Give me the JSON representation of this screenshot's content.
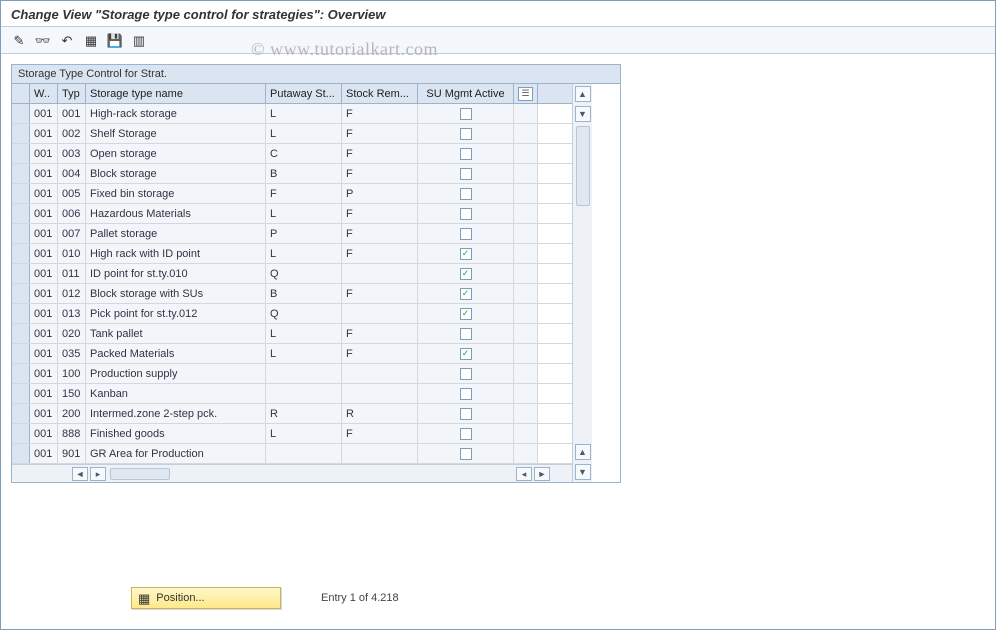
{
  "title": "Change View \"Storage type control for strategies\": Overview",
  "watermark": "© www.tutorialkart.com",
  "toolbar_icons": [
    {
      "name": "change-icon",
      "glyph": "✎"
    },
    {
      "name": "glasses-icon",
      "glyph": "👓"
    },
    {
      "name": "undo-icon",
      "glyph": "↶"
    },
    {
      "name": "select-all-icon",
      "glyph": "▦"
    },
    {
      "name": "save-icon",
      "glyph": "💾"
    },
    {
      "name": "deselect-icon",
      "glyph": "▥"
    }
  ],
  "grid": {
    "title": "Storage Type Control for Strat.",
    "columns": {
      "w": "W..",
      "typ": "Typ",
      "name": "Storage type name",
      "putaway": "Putaway St...",
      "stockrem": "Stock Rem...",
      "su": "SU Mgmt Active",
      "config": ""
    },
    "rows": [
      {
        "w": "001",
        "typ": "001",
        "name": "High-rack storage",
        "put": "L",
        "stk": "F",
        "su": false
      },
      {
        "w": "001",
        "typ": "002",
        "name": "Shelf Storage",
        "put": "L",
        "stk": "F",
        "su": false
      },
      {
        "w": "001",
        "typ": "003",
        "name": "Open storage",
        "put": "C",
        "stk": "F",
        "su": false
      },
      {
        "w": "001",
        "typ": "004",
        "name": "Block storage",
        "put": "B",
        "stk": "F",
        "su": false
      },
      {
        "w": "001",
        "typ": "005",
        "name": "Fixed bin storage",
        "put": "F",
        "stk": "P",
        "su": false
      },
      {
        "w": "001",
        "typ": "006",
        "name": "Hazardous Materials",
        "put": "L",
        "stk": "F",
        "su": false
      },
      {
        "w": "001",
        "typ": "007",
        "name": "Pallet storage",
        "put": "P",
        "stk": "F",
        "su": false
      },
      {
        "w": "001",
        "typ": "010",
        "name": "High rack with ID point",
        "put": "L",
        "stk": "F",
        "su": true
      },
      {
        "w": "001",
        "typ": "011",
        "name": "ID point for st.ty.010",
        "put": "Q",
        "stk": "",
        "su": true
      },
      {
        "w": "001",
        "typ": "012",
        "name": "Block storage with SUs",
        "put": "B",
        "stk": "F",
        "su": true
      },
      {
        "w": "001",
        "typ": "013",
        "name": "Pick point for st.ty.012",
        "put": "Q",
        "stk": "",
        "su": true
      },
      {
        "w": "001",
        "typ": "020",
        "name": "Tank pallet",
        "put": "L",
        "stk": "F",
        "su": false
      },
      {
        "w": "001",
        "typ": "035",
        "name": "Packed Materials",
        "put": "L",
        "stk": "F",
        "su": true
      },
      {
        "w": "001",
        "typ": "100",
        "name": "Production supply",
        "put": "",
        "stk": "",
        "su": false
      },
      {
        "w": "001",
        "typ": "150",
        "name": "Kanban",
        "put": "",
        "stk": "",
        "su": false
      },
      {
        "w": "001",
        "typ": "200",
        "name": "Intermed.zone 2-step pck.",
        "put": "R",
        "stk": "R",
        "su": false
      },
      {
        "w": "001",
        "typ": "888",
        "name": "Finished goods",
        "put": "L",
        "stk": "F",
        "su": false
      },
      {
        "w": "001",
        "typ": "901",
        "name": "GR Area for Production",
        "put": "",
        "stk": "",
        "su": false
      }
    ]
  },
  "footer": {
    "position_label": "Position...",
    "entry_text": "Entry 1 of 4.218"
  }
}
